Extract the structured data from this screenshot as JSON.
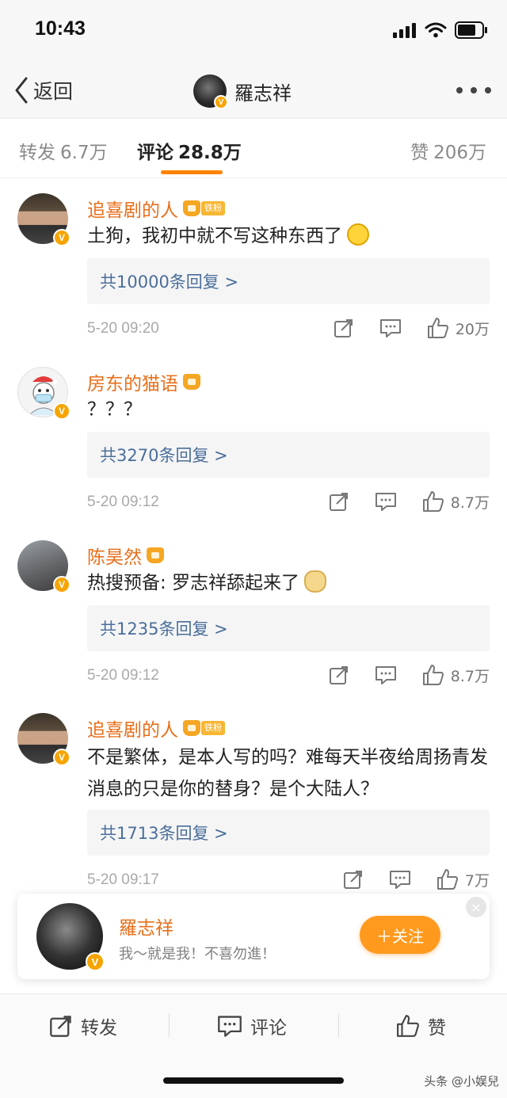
{
  "status_bar": {
    "time": "10:43"
  },
  "nav": {
    "back_label": "返回",
    "title": "羅志祥"
  },
  "tabs": {
    "forward_label": "转发",
    "forward_count": "6.7万",
    "comment_label": "评论",
    "comment_count": "28.8万",
    "like_label": "赞",
    "like_count": "206万"
  },
  "comments": [
    {
      "name": "追喜剧的人",
      "fan_badge": "铁粉",
      "text": "土狗，我初中就不写这种东西了",
      "emoji": "laughing-crying-emoji",
      "replies": "共10000条回复 >",
      "time": "5-20 09:20",
      "likes": "20万"
    },
    {
      "name": "房东的猫语",
      "fan_badge": "",
      "text": "？？？",
      "replies": "共3270条回复 >",
      "time": "5-20 09:12",
      "likes": "8.7万"
    },
    {
      "name": "陈昊然",
      "fan_badge": "",
      "text": "热搜预备: 罗志祥舔起来了",
      "emoji": "doge-emoji",
      "replies": "共1235条回复 >",
      "time": "5-20 09:12",
      "likes": "8.7万"
    },
    {
      "name": "追喜剧的人",
      "fan_badge": "铁粉",
      "text": "不是繁体，是本人写的吗？难每天半夜给周扬青发消息的只是你的替身？是个大陆人？",
      "replies": "共1713条回复 >",
      "time": "5-20 09:17",
      "likes": "7万"
    }
  ],
  "popup": {
    "name": "羅志祥",
    "bio": "我～就是我！不喜勿進！",
    "follow_label": "＋关注",
    "close_symbol": "×"
  },
  "bottom_bar": {
    "forward": "转发",
    "comment": "评论",
    "like": "赞"
  },
  "watermark": "头条 @小娱兒",
  "colors": {
    "accent": "#ff8200",
    "username": "#e86f1a",
    "reply_link": "#4a6e9a",
    "verified": "#f7a400"
  }
}
